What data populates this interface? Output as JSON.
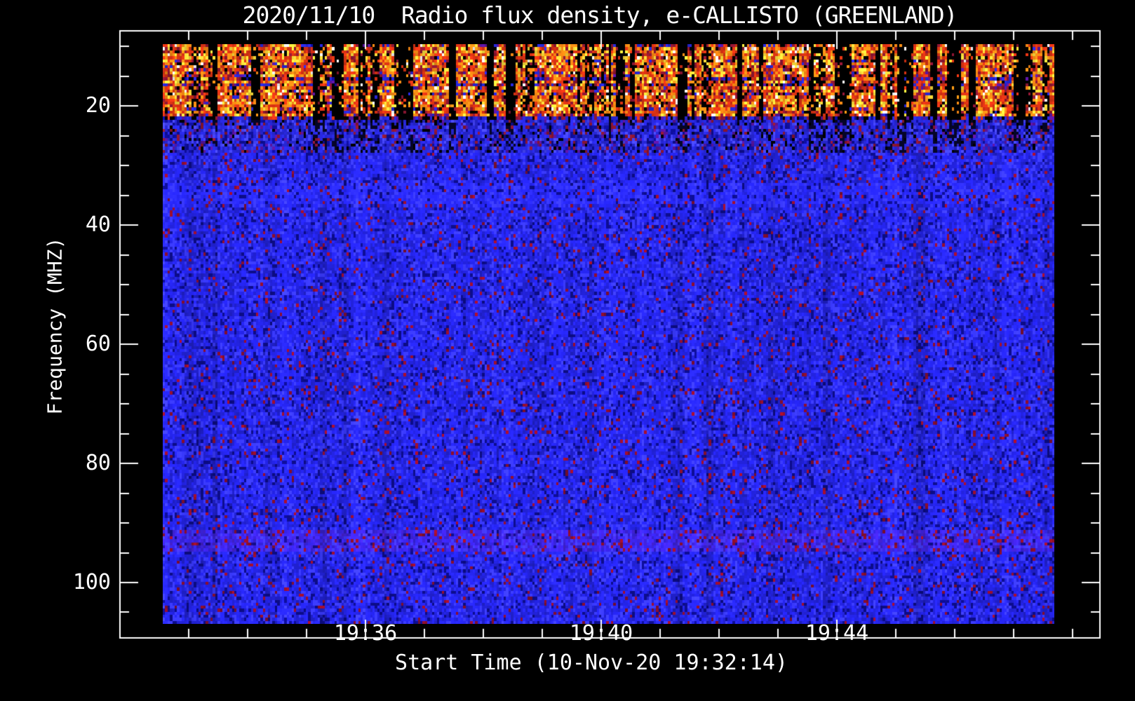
{
  "chart_data": {
    "type": "heatmap",
    "variant": "radio-spectrogram",
    "title": "2020/11/10  Radio flux density, e-CALLISTO (GREENLAND)",
    "xlabel": "Start Time (10-Nov-20 19:32:14)",
    "ylabel": "Frequency (MHZ)",
    "x_ticks": [
      "19:36",
      "19:40",
      "19:44"
    ],
    "x_minor_tick_interval_minutes": 1,
    "y_ticks": [
      "20",
      "40",
      "60",
      "80",
      "100"
    ],
    "y_minor_tick_interval_mhz": 5,
    "y_axis_inverted_mhz_range": [
      7.4,
      109.3
    ],
    "observation": {
      "date": "2020/11/10",
      "quantity": "Radio flux density",
      "instrument": "e-CALLISTO",
      "station": "GREENLAND",
      "start_time": "19:32:14"
    },
    "bands": [
      {
        "freq_mhz": [
          9.6,
          22.3
        ],
        "label": "strong RFI interference band",
        "appearance": "dense speckle of red, orange, yellow and white with black dropout streaks"
      },
      {
        "freq_mhz": [
          22.3,
          28.0
        ],
        "label": "transition band",
        "appearance": "blue with extra red speckle and fading dark vertical streaks"
      },
      {
        "freq_mhz": [
          28.0,
          106.9
        ],
        "label": "quiet background",
        "appearance": "uniform blue with faint dark-red / dark-blue speckle and vertical striping"
      }
    ],
    "palette": {
      "background": "#000000",
      "frame_and_text": "#ffffff",
      "black": "#000000",
      "blue": "#2828dc",
      "blue_bright": "#4646ff",
      "blue_dark": "#0e0e96",
      "purple": "#5a14a0",
      "dark_red": "#8c1632",
      "red": "#e03414",
      "orange": "#ff8c14",
      "yellow": "#ffe13c",
      "white": "#ffffff"
    },
    "render": {
      "seed": 20201110,
      "f_top_mhz": 9.6,
      "f_bottom_mhz": 106.9,
      "rfi_max_mhz": 22.3,
      "transition_max_mhz": 28.0,
      "hot_rows": [
        {
          "f": 10.2,
          "s": 0.75
        },
        {
          "f": 11.4,
          "s": 1.25
        },
        {
          "f": 13.6,
          "s": 1.35
        },
        {
          "f": 16.1,
          "s": 0.8
        },
        {
          "f": 17.7,
          "s": 0.6
        },
        {
          "f": 19.4,
          "s": 1.45
        },
        {
          "f": 21.0,
          "s": 0.9
        }
      ],
      "tint_bands": [
        {
          "f_lo": 33.0,
          "f_hi": 36.5,
          "effect": "lighter"
        },
        {
          "f_lo": 91.0,
          "f_hi": 94.5,
          "effect": "red_tint"
        }
      ],
      "black_streak_count": 60
    }
  }
}
